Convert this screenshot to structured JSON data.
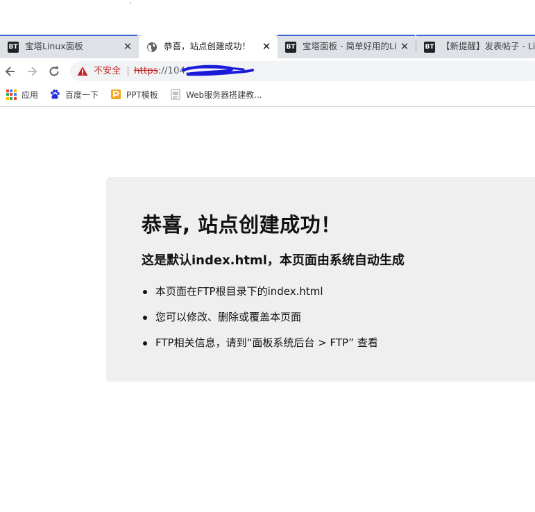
{
  "tabs": [
    {
      "icon": "bt-icon",
      "badge": "BT",
      "title": "宝塔Linux面板",
      "active": false
    },
    {
      "icon": "globe-icon",
      "title": "恭喜，站点创建成功！",
      "active": true
    },
    {
      "icon": "bt-icon",
      "badge": "BT",
      "title": "宝塔面板 - 简单好用的Lin",
      "active": false
    },
    {
      "icon": "bt-icon",
      "badge": "BT",
      "title": "【新提醒】发表帖子 - Lin",
      "active": false
    }
  ],
  "omnibox": {
    "security_label": "不安全",
    "url_scheme": "https",
    "url_rest": "://104."
  },
  "bookmarks": [
    {
      "icon": "apps-icon",
      "label": "应用"
    },
    {
      "icon": "baidu-paw-icon",
      "label": "百度一下"
    },
    {
      "icon": "ppt-icon",
      "label": "PPT模板"
    },
    {
      "icon": "page-icon",
      "label": "Web服务器搭建教..."
    }
  ],
  "page": {
    "title": "恭喜, 站点创建成功！",
    "subtitle": "这是默认index.html，本页面由系统自动生成",
    "items": [
      "本页面在FTP根目录下的index.html",
      "您可以修改、删除或覆盖本页面",
      "FTP相关信息，请到“面板系统后台 > FTP” 查看"
    ]
  },
  "colors": {
    "tabstrip": "#dee1e6",
    "insecure_red": "#c5221f",
    "card_bg": "#efefef",
    "scribble_blue": "#1a1adb"
  }
}
